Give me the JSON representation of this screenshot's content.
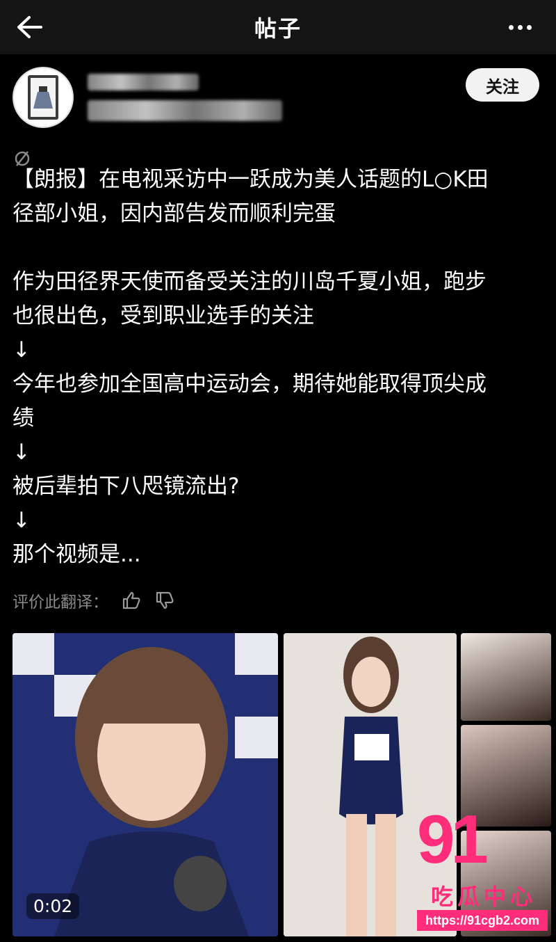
{
  "header": {
    "title": "帖子"
  },
  "post": {
    "follow_label": "关注",
    "content": {
      "line1": "【朗报】在电视采访中一跃成为美人话题的L○K田",
      "line2": "径部小姐，因内部告发而顺利完蛋",
      "line3": "作为田径界天使而备受关注的川岛千夏小姐，跑步",
      "line4": "也很出色，受到职业选手的关注",
      "arrow1": "↓",
      "line5": "今年也参加全国高中运动会，期待她能取得顶尖成",
      "line6": "绩",
      "arrow2": "↓",
      "line7": "被后辈拍下八咫镜流出?",
      "arrow3": "↓",
      "line8": "那个视频是..."
    },
    "rate_label": "评价此翻译：",
    "video_duration": "0:02"
  },
  "watermark": {
    "number": "91",
    "text": "吃瓜中心",
    "url": "https://91cgb2.com"
  }
}
